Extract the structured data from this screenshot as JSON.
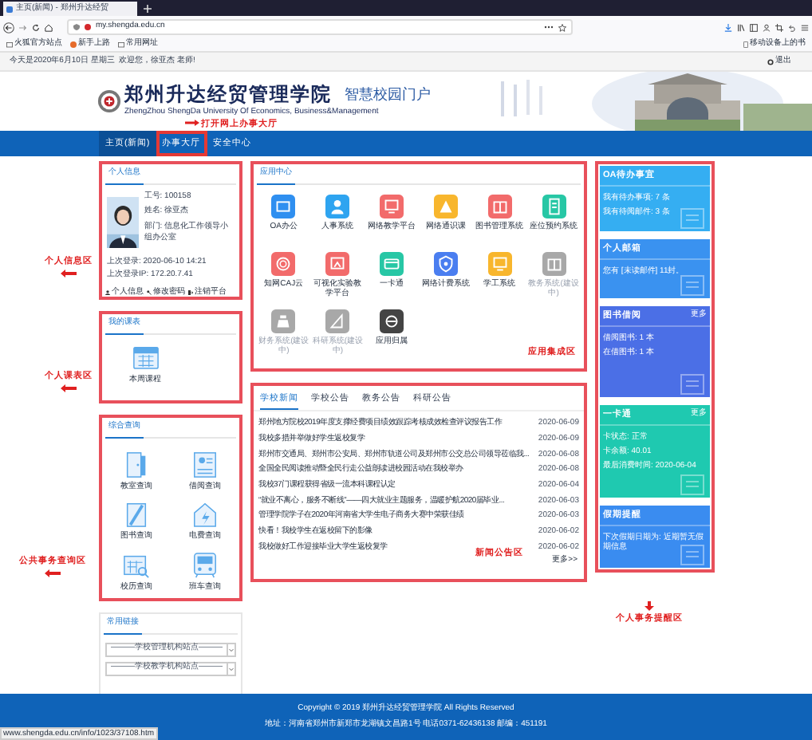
{
  "browser": {
    "tab_title": "主页(新闻) - 郑州升达经贸",
    "url": "my.shengda.edu.cn",
    "bookmarks": [
      "火狐官方站点",
      "新手上路",
      "常用网址"
    ],
    "mobile_bookmarks": "移动设备上的书"
  },
  "top_bar": {
    "greeting": "今天是2020年6月10日 星期三  欢迎您，徐亚杰 老师!",
    "logout": "退出"
  },
  "header": {
    "school_name": "郑州升达经贸管理学院",
    "english_name": "ZhengZhou ShengDa University Of Economics, Business&Management",
    "portal_name": "智慧校园门户"
  },
  "nav": [
    {
      "label": "主页(新闻)",
      "selected": true
    },
    {
      "label": "办事大厅",
      "selected": false
    },
    {
      "label": "安全中心",
      "selected": false
    }
  ],
  "profile": {
    "title": "个人信息",
    "fields": [
      "工号: 100158",
      "姓名: 徐亚杰",
      "部门: 信息化工作领导小组办公室"
    ],
    "last_login": "上次登录: 2020-06-10 14:21",
    "last_ip": "上次登录IP: 172.20.7.41",
    "links": [
      "个人信息",
      "修改密码",
      "注销平台"
    ]
  },
  "schedule": {
    "title": "我的课表",
    "item": "本周课程"
  },
  "queries": {
    "title": "综合查询",
    "items": [
      "教室查询",
      "借阅查询",
      "图书查询",
      "电费查询",
      "校历查询",
      "班车查询"
    ]
  },
  "links": {
    "title": "常用链接",
    "selects": [
      "———学校管理机构站点———",
      "———学校教学机构站点———"
    ]
  },
  "apps": {
    "title": "应用中心",
    "items": [
      {
        "label": "OA办公",
        "color": "#2f8ff0",
        "disabled": false
      },
      {
        "label": "人事系统",
        "color": "#2ea4f0",
        "disabled": false
      },
      {
        "label": "网络教学平台",
        "color": "#f26b6b",
        "disabled": false
      },
      {
        "label": "网络通识课",
        "color": "#f8b62d",
        "disabled": false
      },
      {
        "label": "图书管理系统",
        "color": "#f26b6b",
        "disabled": false
      },
      {
        "label": "座位预约系统",
        "color": "#27c7a5",
        "disabled": false
      },
      {
        "label": "知网CAJ云",
        "color": "#f26b6b",
        "disabled": false
      },
      {
        "label": "可视化实验教学平台",
        "color": "#f26b6b",
        "disabled": false
      },
      {
        "label": "一卡通",
        "color": "#27c7a5",
        "disabled": false
      },
      {
        "label": "网络计费系统",
        "color": "#4a7ef0",
        "disabled": false
      },
      {
        "label": "学工系统",
        "color": "#f8b62d",
        "disabled": false
      },
      {
        "label": "教务系统(建设中)",
        "color": "#a8a8a8",
        "disabled": true
      },
      {
        "label": "财务系统(建设中)",
        "color": "#a8a8a8",
        "disabled": true
      },
      {
        "label": "科研系统(建设中)",
        "color": "#a8a8a8",
        "disabled": true
      },
      {
        "label": "应用归属",
        "color": "#444444",
        "disabled": false
      }
    ]
  },
  "news": {
    "tabs": [
      {
        "label": "学校新闻",
        "selected": true
      },
      {
        "label": "学校公告",
        "selected": false
      },
      {
        "label": "教务公告",
        "selected": false
      },
      {
        "label": "科研公告",
        "selected": false
      }
    ],
    "rows": [
      {
        "title": "郑州地方院校2019年度支撑经费项目绩效跟踪考核成效检查评议报告工作",
        "date": "2020-06-09"
      },
      {
        "title": "我校多措并举做好学生返校复学",
        "date": "2020-06-09"
      },
      {
        "title": "郑州市交通局、郑州市公安局、郑州市轨道公司及郑州市公交总公司领导莅临我...",
        "date": "2020-06-08"
      },
      {
        "title": "全国全民阅读推动暨全民行走公益朗读进校园活动在我校举办",
        "date": "2020-06-08"
      },
      {
        "title": "我校37门课程获得省级一流本科课程认定",
        "date": "2020-06-04"
      },
      {
        "title": "“就业不离心，服务不断线”——四大就业主题服务，温暖护航2020届毕业...",
        "date": "2020-06-03"
      },
      {
        "title": "管理学院学子在2020年河南省大学生电子商务大赛中荣获佳绩",
        "date": "2020-06-03"
      },
      {
        "title": "快看！我校学生在返校留下的影像",
        "date": "2020-06-02"
      },
      {
        "title": "我校做好工作迎接毕业大学生返校复学",
        "date": "2020-06-02"
      }
    ],
    "more": "更多>>"
  },
  "reminders": [
    {
      "title": "OA待办事宜",
      "lines": [
        "我有待办事项: 7 条",
        "我有待阅邮件: 3 条"
      ],
      "color": "#35aef2"
    },
    {
      "title": "个人邮箱",
      "lines": [
        "您有 [未读邮件] 11封。"
      ],
      "color": "#3a92f0"
    },
    {
      "title": "图书借阅",
      "more": "更多",
      "lines": [
        "借阅图书: 1 本",
        "在借图书: 1 本"
      ],
      "color": "#4b6fe6"
    },
    {
      "title": "一卡通",
      "more": "更多",
      "lines": [
        "卡状态: 正常",
        "卡余额: 40.01",
        "最后消费时间: 2020-06-04"
      ],
      "color": "#1fc9b0"
    },
    {
      "title": "假期提醒",
      "lines": [
        "下次假期日期为: 近期暂无假期信息"
      ],
      "color": "#3a8cf0"
    }
  ],
  "annotations": [
    "打开网上办事大厅",
    "个人信息区",
    "个人课表区",
    "公共事务查询区",
    "应用集成区",
    "新闻公告区",
    "个人事务提醒区"
  ],
  "footer": {
    "copyright": "Copyright © 2019 郑州升达经贸管理学院 All Rights Reserved",
    "address": "地址：河南省郑州市新郑市龙湖镇文昌路1号 电话0371-62436138 邮编：451191"
  },
  "status_url": "www.shengda.edu.cn/info/1023/37108.htm"
}
